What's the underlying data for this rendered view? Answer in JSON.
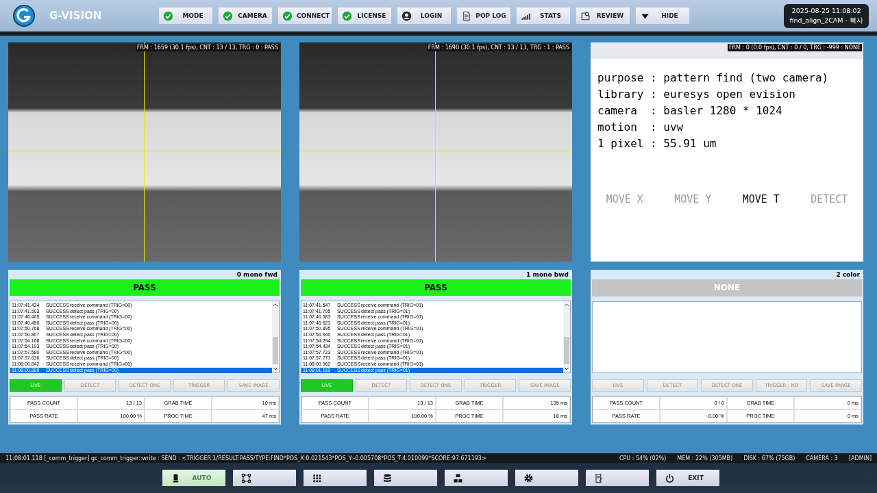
{
  "app": {
    "title": "G-VISION"
  },
  "toolbar": [
    {
      "label": "MODE"
    },
    {
      "label": "CAMERA"
    },
    {
      "label": "CONNECT"
    },
    {
      "label": "LICENSE"
    },
    {
      "label": "LOGIN"
    },
    {
      "label": "POP LOG"
    },
    {
      "label": "STATS"
    },
    {
      "label": "REVIEW"
    },
    {
      "label": "HIDE"
    }
  ],
  "clock": {
    "datetime": "2025-08-25 11:08:02",
    "recipe": "find_align_2CAM - 복사"
  },
  "views": [
    {
      "kind": "camera",
      "overlay": "FRM : 1659 (30.1 fps), CNT : 13 / 13, TRG : 0 : PASS"
    },
    {
      "kind": "camera",
      "overlay": "FRM : 1690 (30.1 fps), CNT : 13 / 13, TRG : 1 : PASS"
    },
    {
      "kind": "info",
      "overlay": "FRM : 0 (0.0 fps), CNT : 0 / 0, TRG : -999 : NONE",
      "lines": [
        "purpose : pattern find (two camera)",
        "library : euresys open evision",
        "camera  : basler 1280 * 1024",
        "motion  : uvw",
        "1 pixel : 55.91 um"
      ],
      "moves": [
        {
          "label": "MOVE X",
          "disabled": true
        },
        {
          "label": "MOVE Y",
          "disabled": true
        },
        {
          "label": "MOVE T",
          "disabled": false
        },
        {
          "label": "DETECT",
          "disabled": true
        }
      ]
    }
  ],
  "panels": [
    {
      "name": "0 mono fwd",
      "result": "PASS",
      "kind": "pass",
      "log": [
        {
          "time": "11:07:41.434",
          "status": "SUCCESS",
          "message": "receive command (TRIG=00)",
          "selected": false
        },
        {
          "time": "11:07:41.503",
          "status": "SUCCESS",
          "message": "detect pass (TRIG=00)",
          "selected": false
        },
        {
          "time": "11:07:46.405",
          "status": "SUCCESS",
          "message": "receive command (TRIG=00)",
          "selected": false
        },
        {
          "time": "11:07:46.450",
          "status": "SUCCESS",
          "message": "detect pass (TRIG=00)",
          "selected": false
        },
        {
          "time": "11:07:50.768",
          "status": "SUCCESS",
          "message": "receive command (TRIG=00)",
          "selected": false
        },
        {
          "time": "11:07:50.807",
          "status": "SUCCESS",
          "message": "detect pass (TRIG=00)",
          "selected": false
        },
        {
          "time": "11:07:54.168",
          "status": "SUCCESS",
          "message": "receive command (TRIG=00)",
          "selected": false
        },
        {
          "time": "11:07:54.193",
          "status": "SUCCESS",
          "message": "detect pass (TRIG=00)",
          "selected": false
        },
        {
          "time": "11:07:57.580",
          "status": "SUCCESS",
          "message": "receive command (TRIG=00)",
          "selected": false
        },
        {
          "time": "11:07:57.636",
          "status": "SUCCESS",
          "message": "detect pass (TRIG=00)",
          "selected": false
        },
        {
          "time": "11:08:00.842",
          "status": "SUCCESS",
          "message": "receive command (TRIG=00)",
          "selected": false
        },
        {
          "time": "11:08:00.885",
          "status": "SUCCESS",
          "message": "detect pass (TRIG=00)",
          "selected": true
        }
      ],
      "buttons": [
        {
          "label": "LIVE",
          "active": true
        },
        {
          "label": "DETECT",
          "active": false
        },
        {
          "label": "DETECT ONE",
          "active": false
        },
        {
          "label": "TRIGGER",
          "active": false
        },
        {
          "label": "SAVE IMAGE",
          "active": false
        }
      ],
      "stats": [
        [
          "PASS COUNT",
          "13 / 13",
          "GRAB TIME",
          "10 ms"
        ],
        [
          "PASS RATE",
          "100.00 %",
          "PROC TIME",
          "47 ms"
        ]
      ]
    },
    {
      "name": "1 mono bwd",
      "result": "PASS",
      "kind": "pass",
      "log": [
        {
          "time": "11:07:41.547",
          "status": "SUCCESS",
          "message": "receive command (TRIG=01)",
          "selected": false
        },
        {
          "time": "11:07:41.705",
          "status": "SUCCESS",
          "message": "detect pass (TRIG=01)",
          "selected": false
        },
        {
          "time": "11:07:46.583",
          "status": "SUCCESS",
          "message": "receive command (TRIG=01)",
          "selected": false
        },
        {
          "time": "11:07:46.623",
          "status": "SUCCESS",
          "message": "detect pass (TRIG=01)",
          "selected": false
        },
        {
          "time": "11:07:50.895",
          "status": "SUCCESS",
          "message": "receive command (TRIG=01)",
          "selected": false
        },
        {
          "time": "11:07:50.940",
          "status": "SUCCESS",
          "message": "detect pass (TRIG=01)",
          "selected": false
        },
        {
          "time": "11:07:54.294",
          "status": "SUCCESS",
          "message": "receive command (TRIG=01)",
          "selected": false
        },
        {
          "time": "11:07:54.434",
          "status": "SUCCESS",
          "message": "detect pass (TRIG=01)",
          "selected": false
        },
        {
          "time": "11:07:57.723",
          "status": "SUCCESS",
          "message": "receive command (TRIG=01)",
          "selected": false
        },
        {
          "time": "11:07:57.771",
          "status": "SUCCESS",
          "message": "detect pass (TRIG=01)",
          "selected": false
        },
        {
          "time": "11:08:00.962",
          "status": "SUCCESS",
          "message": "receive command (TRIG=01)",
          "selected": false
        },
        {
          "time": "11:08:01.118",
          "status": "SUCCESS",
          "message": "detect pass (TRIG=01)",
          "selected": true
        }
      ],
      "buttons": [
        {
          "label": "LIVE",
          "active": true
        },
        {
          "label": "DETECT",
          "active": false
        },
        {
          "label": "DETECT ONE",
          "active": false
        },
        {
          "label": "TRIGGER",
          "active": false
        },
        {
          "label": "SAVE IMAGE",
          "active": false
        }
      ],
      "stats": [
        [
          "PASS COUNT",
          "13 / 13",
          "GRAB TIME",
          "135 ms"
        ],
        [
          "PASS RATE",
          "100.00 %",
          "PROC TIME",
          "16 ms"
        ]
      ]
    },
    {
      "name": "2 color",
      "result": "NONE",
      "kind": "none",
      "buttons": [
        {
          "label": "LIVE",
          "active": false
        },
        {
          "label": "DETECT",
          "active": false
        },
        {
          "label": "DETECT ONE",
          "active": false
        },
        {
          "label": "TRIGGER : NO",
          "active": false
        },
        {
          "label": "SAVE IMAGE",
          "active": false
        }
      ],
      "stats": [
        [
          "PASS COUNT",
          "0 / 0",
          "GRAB TIME",
          "0 ms"
        ],
        [
          "PASS RATE",
          "0.00 %",
          "PROC TIME",
          "0 ms"
        ]
      ]
    }
  ],
  "status_bar": {
    "message": "11:08:01.118  [_comm_trigger] gc_comm_trigger::write : SEND : <TRIGGER:1/RESULT:PASS/TYPE:FIND*POS_X:0.021543*POS_Y:-0.005708*POS_T:4.010099*SCORE:97.671193>",
    "cpu": "CPU : 54% (02%)",
    "mem": "MEM : 22% (305MB)",
    "disk": "DISK : 67% (75GB)",
    "camera": "CAMERA : 3",
    "user": "[ADMIN]"
  },
  "bottom_bar": [
    {
      "label": "AUTO",
      "selected": true
    },
    {
      "selected": false
    },
    {
      "selected": false
    },
    {
      "selected": false
    },
    {
      "selected": false
    },
    {
      "selected": false
    },
    {
      "selected": false
    },
    {
      "label": "EXIT",
      "selected": false
    }
  ]
}
